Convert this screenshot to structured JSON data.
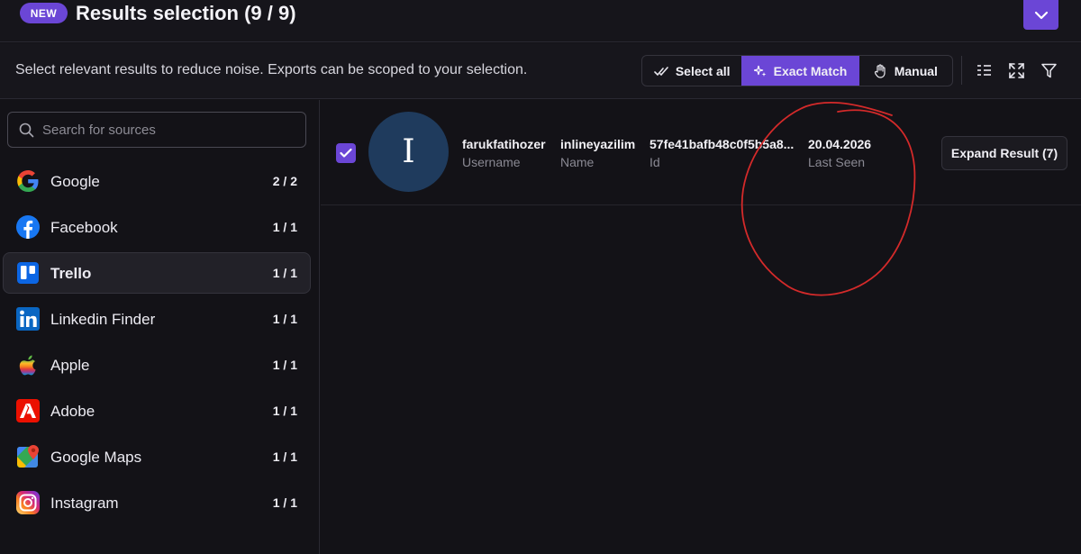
{
  "header": {
    "badge": "NEW",
    "title": "Results selection (9 / 9)"
  },
  "toolbar": {
    "hint": "Select relevant results to reduce noise. Exports can be scoped to your selection.",
    "select_all": "Select all",
    "exact_match": "Exact Match",
    "manual": "Manual",
    "active_mode": "Exact Match"
  },
  "search": {
    "placeholder": "Search for sources"
  },
  "sources": [
    {
      "name": "Google",
      "count": "2 / 2",
      "icon": "google-icon"
    },
    {
      "name": "Facebook",
      "count": "1 / 1",
      "icon": "facebook-icon"
    },
    {
      "name": "Trello",
      "count": "1 / 1",
      "icon": "trello-icon",
      "active": true
    },
    {
      "name": "Linkedin Finder",
      "count": "1 / 1",
      "icon": "linkedin-icon"
    },
    {
      "name": "Apple",
      "count": "1 / 1",
      "icon": "apple-icon"
    },
    {
      "name": "Adobe",
      "count": "1 / 1",
      "icon": "adobe-icon"
    },
    {
      "name": "Google Maps",
      "count": "1 / 1",
      "icon": "google-maps-icon"
    },
    {
      "name": "Instagram",
      "count": "1 / 1",
      "icon": "instagram-icon"
    }
  ],
  "result": {
    "checked": true,
    "avatar_letter": "I",
    "username": "farukfatihozer",
    "username_label": "Username",
    "name": "inlineyazilim",
    "name_label": "Name",
    "id": "57fe41bafb48c0f5b5a8...",
    "id_label": "Id",
    "last_seen": "20.04.2026",
    "last_seen_label": "Last Seen",
    "expand_label": "Expand Result (7)"
  },
  "colors": {
    "accent": "#6b46d6",
    "background": "#131217",
    "annotation": "#d42a2a"
  }
}
